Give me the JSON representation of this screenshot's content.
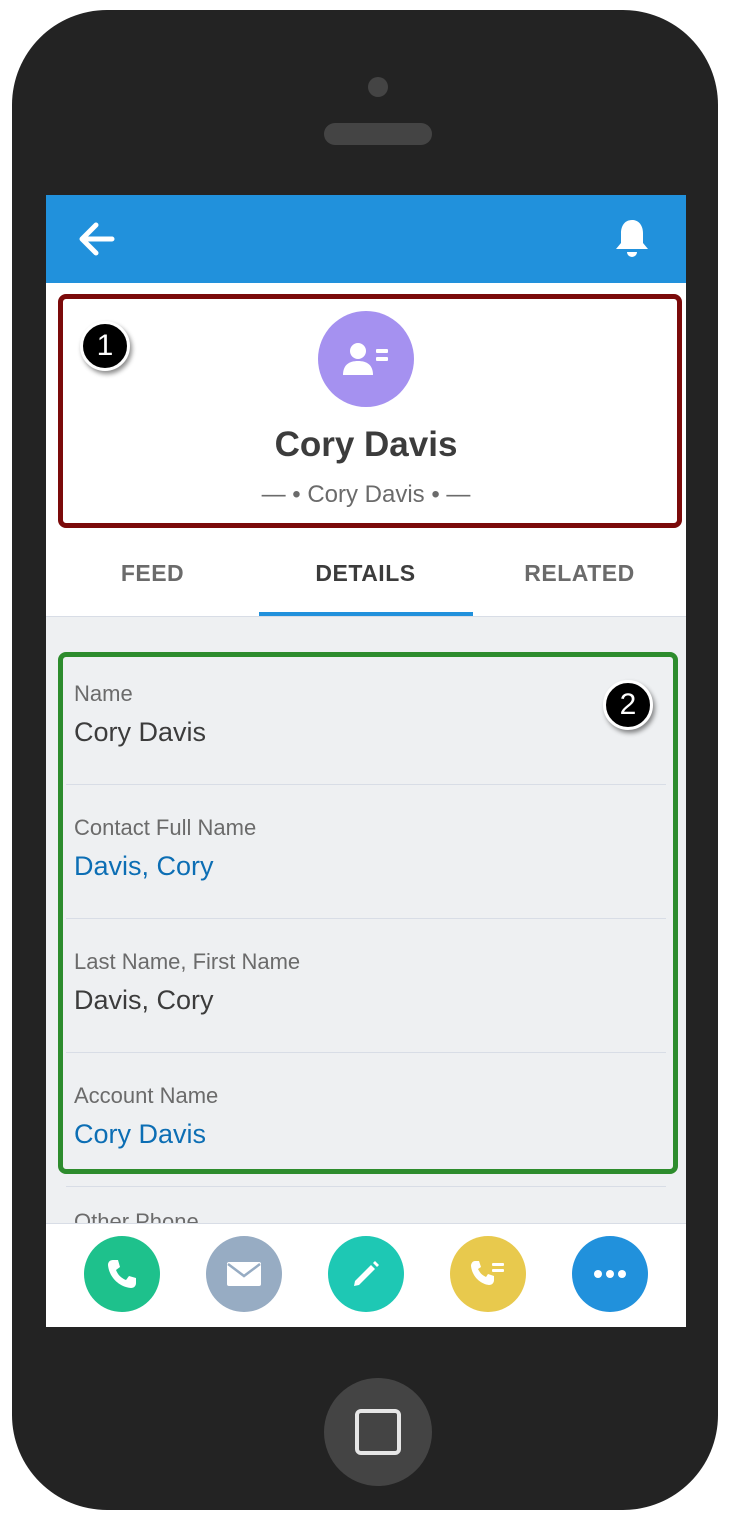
{
  "header": {
    "title": "Cory Davis",
    "subtitle": "— • Cory Davis • —"
  },
  "tabs": [
    {
      "label": "FEED"
    },
    {
      "label": "DETAILS"
    },
    {
      "label": "RELATED"
    }
  ],
  "active_tab": "DETAILS",
  "fields": [
    {
      "label": "Name",
      "value": "Cory Davis"
    },
    {
      "label": "Contact Full Name",
      "value": "Davis, Cory"
    },
    {
      "label": "Last Name, First Name",
      "value": "Davis, Cory"
    },
    {
      "label": "Account Name",
      "value": "Cory Davis"
    }
  ],
  "partial_field_label": "Other Phone",
  "annotations": {
    "badge_1": "1",
    "badge_2": "2",
    "box_1_color": "#7b0a0a",
    "box_2_color": "#2d8c2d"
  },
  "actions": [
    {
      "icon": "phone-icon",
      "color": "#1ec18c"
    },
    {
      "icon": "email-icon",
      "color": "#97acc3"
    },
    {
      "icon": "edit-icon",
      "color": "#1ec8b4"
    },
    {
      "icon": "log-call-icon",
      "color": "#e8c94d"
    },
    {
      "icon": "more-icon",
      "color": "#2191dc"
    }
  ],
  "colors": {
    "brand_header": "#2191dc",
    "avatar": "#a591f0",
    "link": "#0c6eb4"
  }
}
